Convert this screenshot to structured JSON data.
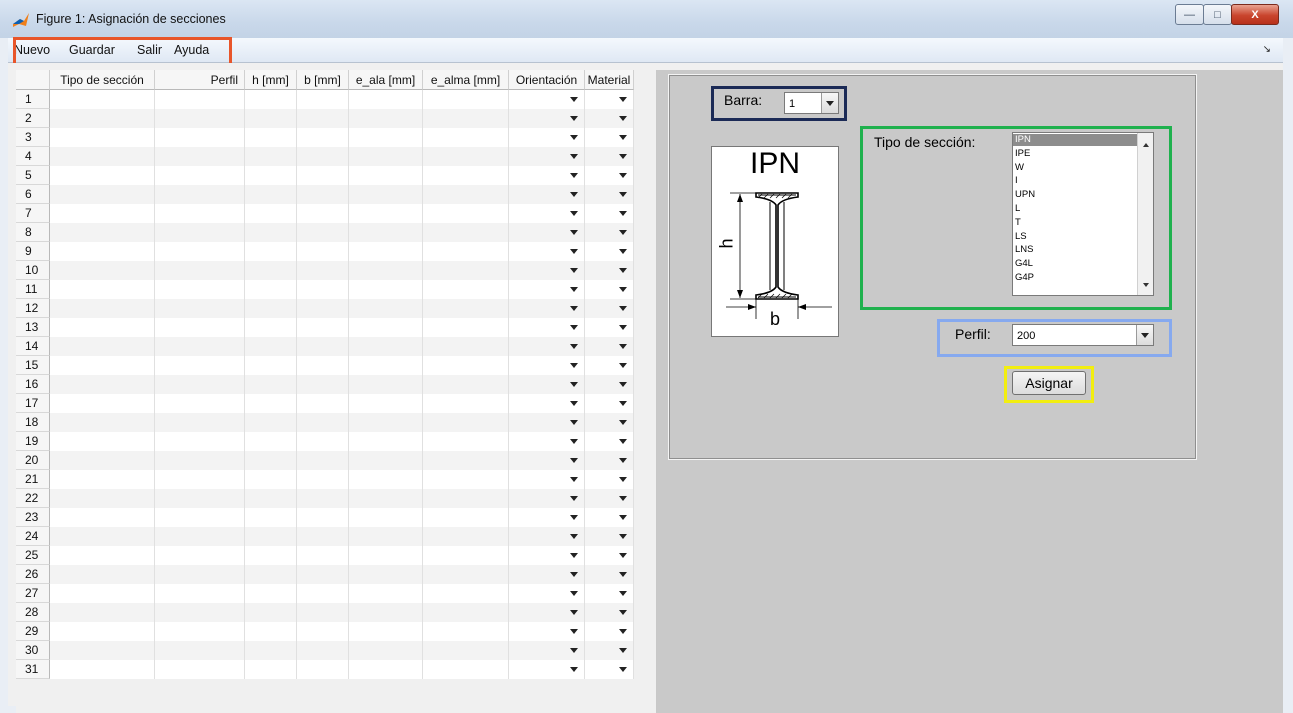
{
  "window": {
    "title": "Figure 1: Asignación de secciones",
    "minimize": "—",
    "maximize": "□",
    "close": "X"
  },
  "menu": [
    "Nuevo",
    "Guardar",
    "Salir",
    "Ayuda"
  ],
  "table": {
    "headers": [
      "Tipo de sección",
      "Perfil",
      "h [mm]",
      "b [mm]",
      "e_ala [mm]",
      "e_alma [mm]",
      "Orientación",
      "Material"
    ],
    "rows": [
      "1",
      "2",
      "3",
      "4",
      "5",
      "6",
      "7",
      "8",
      "9",
      "10",
      "11",
      "12",
      "13",
      "14",
      "15",
      "16",
      "17",
      "18",
      "19",
      "20",
      "21",
      "22",
      "23",
      "24",
      "25",
      "26",
      "27",
      "28",
      "29",
      "30",
      "31"
    ]
  },
  "barra": {
    "label": "Barra:",
    "value": "1"
  },
  "section_type": {
    "label": "Tipo de sección:",
    "options": [
      "IPN",
      "IPE",
      "W",
      "I",
      "UPN",
      "L",
      "T",
      "LS",
      "LNS",
      "G4L",
      "G4P"
    ],
    "selected": "IPN"
  },
  "preview": {
    "title": "IPN",
    "h_label": "h",
    "b_label": "b"
  },
  "perfil": {
    "label": "Perfil:",
    "value": "200"
  },
  "assign_button": "Asignar",
  "colors": {
    "menu_highlight": "#e8552a",
    "barra_highlight": "#1b2a56",
    "tipo_highlight": "#1fb14e",
    "perfil_highlight": "#86a9ef",
    "button_highlight": "#f2ee10"
  }
}
